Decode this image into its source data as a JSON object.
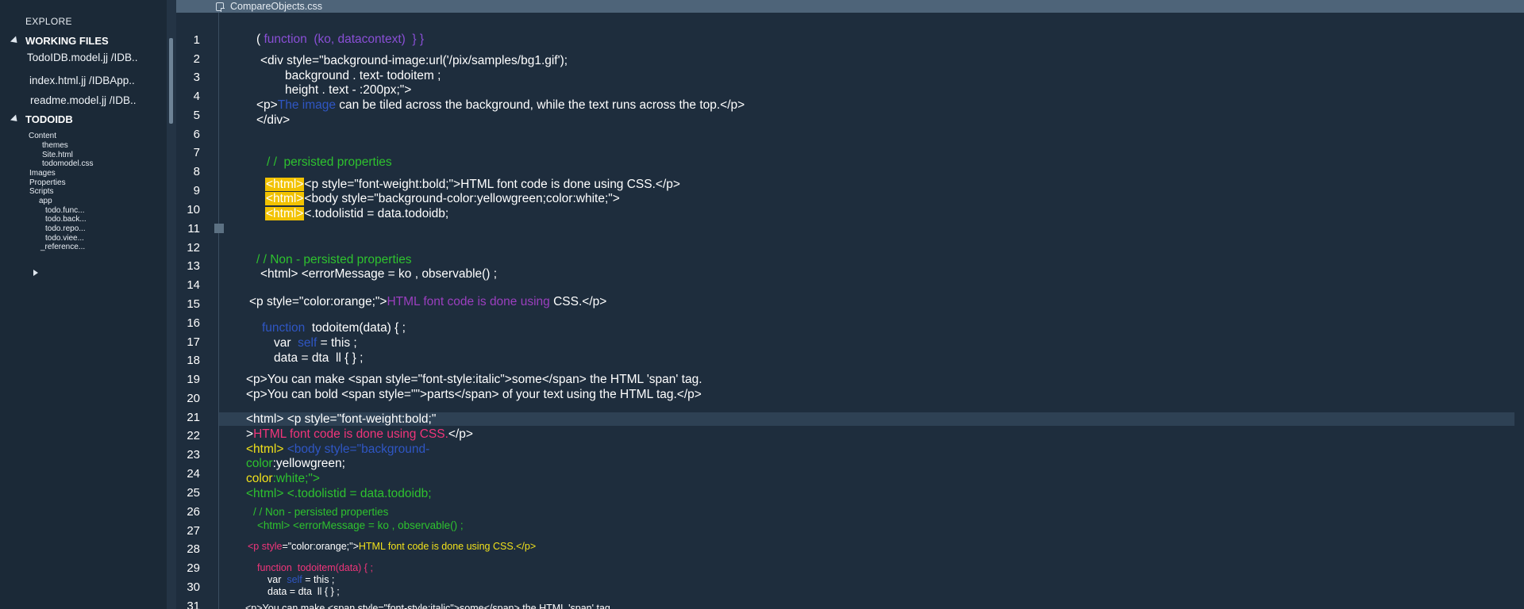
{
  "sidebar": {
    "title": "EXPLORE",
    "working_files": {
      "heading": "WORKING FILES",
      "items": [
        "TodoIDB.model.jj  /IDB..",
        "index.html.jj  /IDBApp..",
        "readme.model.jj  /IDB.."
      ]
    },
    "project": {
      "heading": "TODOIDB",
      "tree": [
        "Content",
        "themes",
        "Site.html",
        "todomodel.css",
        "Images",
        "Properties",
        "Scripts",
        "app",
        "todo.func...",
        "todo.back...",
        "todo.repo...",
        "todo.viee...",
        "_reference..."
      ]
    }
  },
  "editor": {
    "tab": "CompareObjects.css",
    "line_numbers": [
      "1",
      "2",
      "3",
      "4",
      "5",
      "6",
      "7",
      "8",
      "9",
      "10",
      "11",
      "12",
      "13",
      "14",
      "15",
      "16",
      "17",
      "18",
      "19",
      "20",
      "21",
      "22",
      "23",
      "24",
      "25",
      "26",
      "27",
      "28",
      "29",
      "30",
      "31"
    ],
    "lines": {
      "l1_a": "( ",
      "l1_b": "function  (ko, datacontext)  } }",
      "l2": "<div style=\"background-image:url('/pix/samples/bg1.gif');",
      "l3": "background . text- todoitem ;",
      "l4": "height . text - :200px;\">",
      "l5_a": "<p>",
      "l5_b": "The image",
      "l5_c": " can be tiled across the background, while the text runs across the top.</p>",
      "l6": "</div>",
      "l8": "/ /  persisted properties",
      "l9_a": "<html>",
      "l9_b": "<p style=\"font-weight:bold;\">HTML font code is done using CSS.</p>",
      "l10_a": "<html>",
      "l10_b": "<body style=\"background-color:yellowgreen;color:white;\">",
      "l11_a": "<html>",
      "l11_b": "<.todolistid = data.todoidb;",
      "l13": "/ / Non - persisted properties",
      "l14": "<html> <errorMessage = ko , observable() ;",
      "l16_a": "<p style=\"color:orange;\">",
      "l16_b": "HTML font code is done using",
      "l16_c": " CSS.</p>",
      "l17_a": "function  ",
      "l17_b": "todoitem(data) { ;",
      "l18_a": "var  ",
      "l18_b": "self",
      "l18_c": " = this ;",
      "l19": "data = dta  ll { } ;",
      "l20": "<p>You can make <span style=\"font-style:italic\">some</span> the HTML 'span' tag.",
      "l21": "<p>You can bold <span style=\"\">parts</span> of your text using the HTML tag.</p>",
      "l22": "<html> <p style=\"font-weight:bold;\"",
      "l23_a": ">",
      "l23_b": "HTML font code is done using CSS.",
      "l23_c": "</p>",
      "l24_a": "<html> ",
      "l24_b": "<body style=\"background-",
      "l25_a": "color",
      "l25_b": ":yellowgreen;",
      "l26_a": "color",
      "l26_b": ":white;\">",
      "l27": "<html> <.todolistid = data.todoidb;",
      "l28": "/ / Non - persisted properties",
      "l29": "<html> <errorMessage = ko , observable() ;",
      "l30_a": "<p ",
      "l30_b": "style",
      "l30_c": "=\"color:orange;\">",
      "l30_d": "HTML font code is done using CSS.</p>",
      "l31": "function  todoitem(data) { ;",
      "l32_a": "var  ",
      "l32_b": "self",
      "l32_c": " = this ;",
      "l33": "data = dta  ll { } ;",
      "l34": "<p>You can make <span style=\"font-style:italic\">some</span> the HTML 'span' tag."
    }
  },
  "colors": {
    "background": "#1e2d3d",
    "sidebar": "#1b2937",
    "tab_bar": "#4e6479",
    "keyword": "#8a4fd6",
    "blue": "#2f56c4",
    "green": "#2ec22e",
    "purple": "#9b3fbf",
    "pink": "#f0357a",
    "yellow": "#f1e11b",
    "highlight": "#f2c200"
  }
}
